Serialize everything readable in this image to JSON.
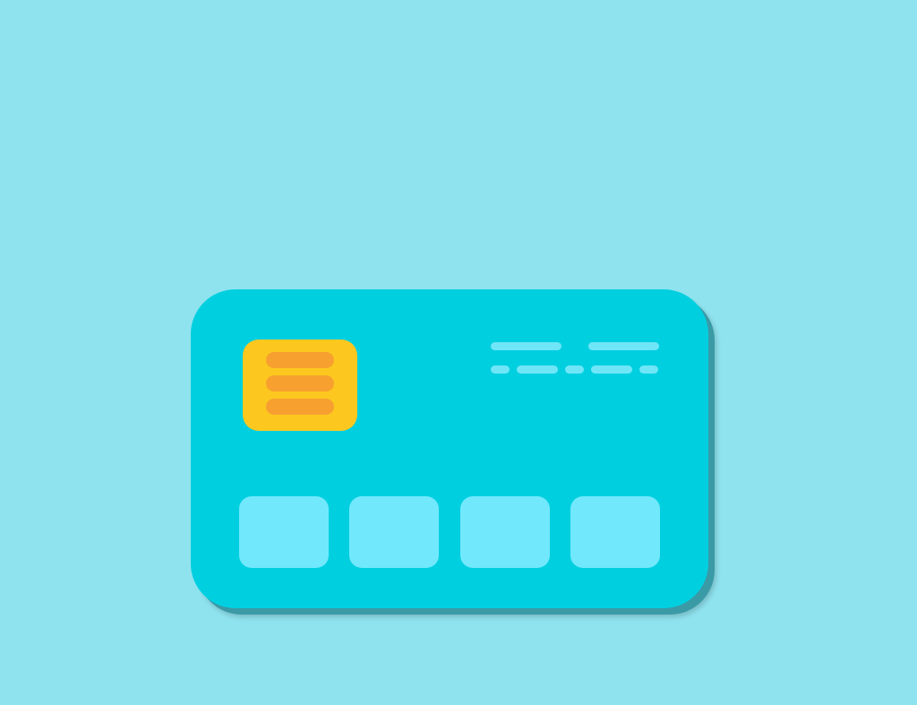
{
  "background_color": "#8fe3ef",
  "card": {
    "icon": "credit-card-icon",
    "body_color": "#00cfe0",
    "shadow_color": "#3a9aa6",
    "chip": {
      "icon": "chip-icon",
      "color": "#fcc81f",
      "line_color": "#f7a030"
    },
    "detail_line_color": "#6fe6f7",
    "number_block_color": "#72e8fd",
    "number_block_count": 4
  }
}
